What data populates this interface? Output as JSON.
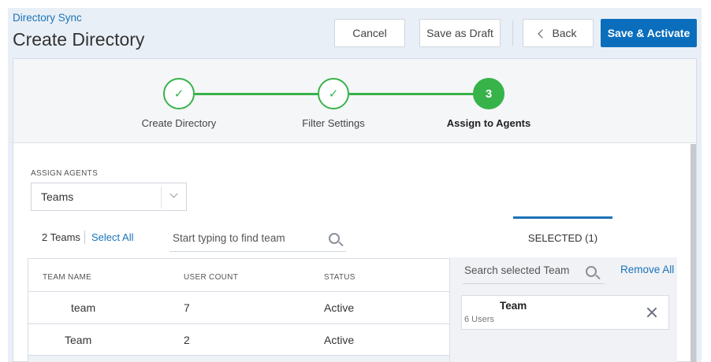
{
  "header": {
    "breadcrumb": "Directory Sync",
    "title": "Create Directory",
    "buttons": {
      "cancel": "Cancel",
      "save_draft": "Save as Draft",
      "back": "Back",
      "save_activate": "Save & Activate"
    },
    "colors": {
      "primary": "#0a6ebd",
      "link": "#1a73b8",
      "success": "#37b34a"
    }
  },
  "stepper": {
    "steps": [
      {
        "label": "Create Directory",
        "state": "done",
        "mark": "✓"
      },
      {
        "label": "Filter Settings",
        "state": "done",
        "mark": "✓"
      },
      {
        "label": "Assign to Agents",
        "state": "active",
        "mark": "3"
      }
    ]
  },
  "assign": {
    "label": "ASSIGN AGENTS",
    "selected_value": "Teams"
  },
  "teams_list": {
    "count_label": "2 Teams",
    "select_all": "Select All",
    "search_placeholder": "Start typing to find team",
    "columns": [
      "TEAM NAME",
      "USER COUNT",
      "STATUS"
    ],
    "rows": [
      {
        "name": "team",
        "user_count": "7",
        "status": "Active"
      },
      {
        "name": "Team",
        "user_count": "2",
        "status": "Active"
      }
    ]
  },
  "selected_panel": {
    "tab_label": "SELECTED (1)",
    "search_placeholder": "Search selected Team",
    "remove_all": "Remove All",
    "items": [
      {
        "name": "Team",
        "users": "6 Users"
      }
    ]
  }
}
